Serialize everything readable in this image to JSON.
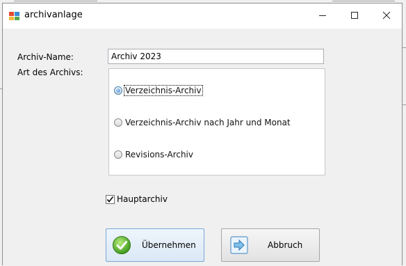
{
  "window": {
    "title": "archivanlage"
  },
  "form": {
    "name_label": "Archiv-Name:",
    "name_value": "Archiv 2023",
    "type_label": "Art des Archivs:",
    "options": [
      {
        "label": "Verzeichnis-Archiv",
        "selected": true
      },
      {
        "label": "Verzeichnis-Archiv nach Jahr und Monat",
        "selected": false
      },
      {
        "label": "Revisions-Archiv",
        "selected": false
      }
    ],
    "main_archive_label": "Hauptarchiv",
    "main_archive_checked": true
  },
  "buttons": {
    "ok_label": "Übernehmen",
    "cancel_label": "Abbruch"
  },
  "icons": {
    "title": "window-app-icon",
    "minimize": "minimize-icon",
    "maximize": "maximize-icon",
    "close": "close-icon",
    "ok": "checkmark-icon",
    "cancel": "arrow-right-icon"
  }
}
